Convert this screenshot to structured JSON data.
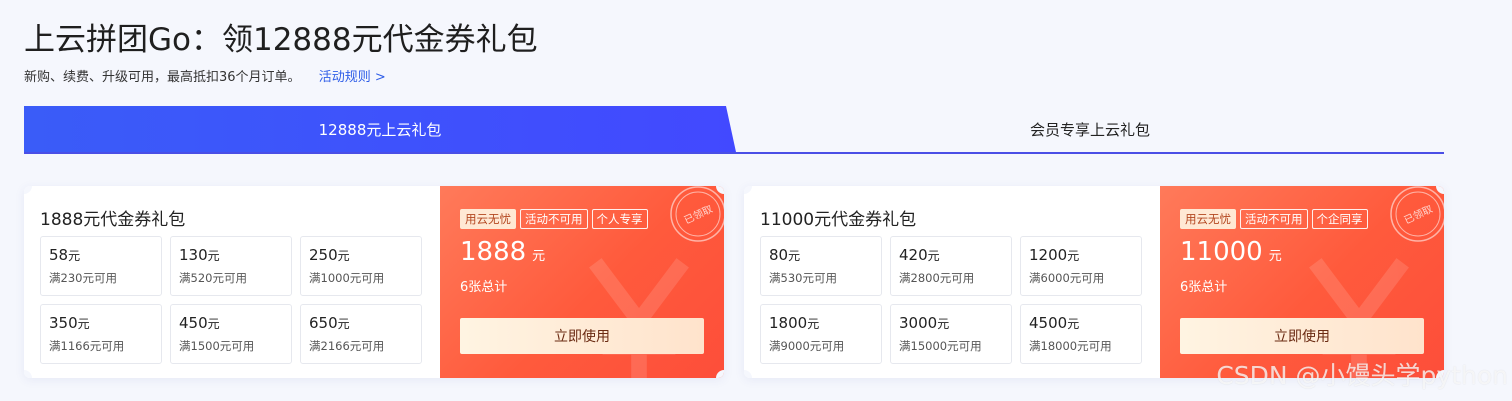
{
  "header": {
    "title": "上云拼团Go：领12888元代金券礼包",
    "subtitle": "新购、续费、升级可用，最高抵扣36个月订单。",
    "rules_link": "活动规则 >"
  },
  "tabs": [
    {
      "label": "12888元上云礼包",
      "active": true
    },
    {
      "label": "会员专享上云礼包",
      "active": false
    }
  ],
  "packages": [
    {
      "title": "1888元代金券礼包",
      "coupons": [
        {
          "amount": "58",
          "unit": "元",
          "condition": "满230元可用"
        },
        {
          "amount": "130",
          "unit": "元",
          "condition": "满520元可用"
        },
        {
          "amount": "250",
          "unit": "元",
          "condition": "满1000元可用"
        },
        {
          "amount": "350",
          "unit": "元",
          "condition": "满1166元可用"
        },
        {
          "amount": "450",
          "unit": "元",
          "condition": "满1500元可用"
        },
        {
          "amount": "650",
          "unit": "元",
          "condition": "满2166元可用"
        }
      ],
      "tags": [
        "用云无忧",
        "活动不可用",
        "个人专享"
      ],
      "total": "1888",
      "total_unit": "元",
      "count": "6张总计",
      "button": "立即使用",
      "stamp": "已领取"
    },
    {
      "title": "11000元代金券礼包",
      "coupons": [
        {
          "amount": "80",
          "unit": "元",
          "condition": "满530元可用"
        },
        {
          "amount": "420",
          "unit": "元",
          "condition": "满2800元可用"
        },
        {
          "amount": "1200",
          "unit": "元",
          "condition": "满6000元可用"
        },
        {
          "amount": "1800",
          "unit": "元",
          "condition": "满9000元可用"
        },
        {
          "amount": "3000",
          "unit": "元",
          "condition": "满15000元可用"
        },
        {
          "amount": "4500",
          "unit": "元",
          "condition": "满18000元可用"
        }
      ],
      "tags": [
        "用云无忧",
        "活动不可用",
        "个企同享"
      ],
      "total": "11000",
      "total_unit": "元",
      "count": "6张总计",
      "button": "立即使用",
      "stamp": "已领取"
    }
  ],
  "watermark": "CSDN @小馒头学python",
  "colors": {
    "accent": "#4249ff",
    "link": "#2f5ee8",
    "coupon_red": "#ff5a3c"
  }
}
